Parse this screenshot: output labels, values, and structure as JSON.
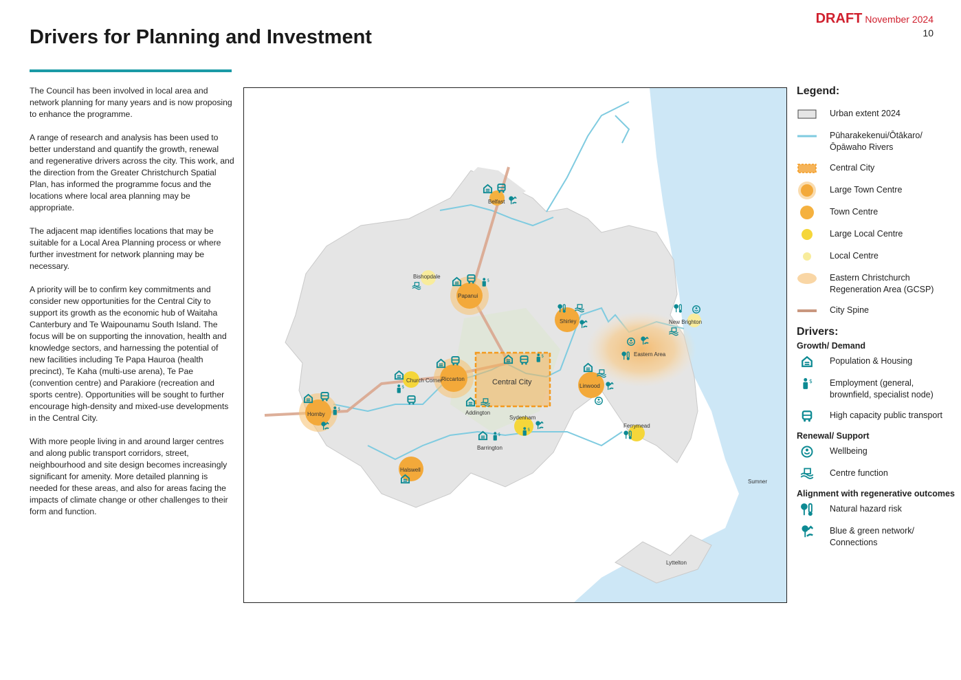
{
  "header": {
    "draft": "DRAFT",
    "date": "November 2024",
    "page": "10"
  },
  "title": "Drivers for Planning and Investment",
  "intro": [
    "The Council has been involved in local area and network planning for many years and is now proposing to enhance the programme.",
    "A range of research and analysis has been used to better understand and quantify the growth, renewal and regenerative drivers across the city. This work, and the direction from the Greater Christchurch Spatial Plan, has informed the programme focus and the locations where local area planning may be appropriate.",
    "The adjacent map identifies locations that may be suitable for a Local Area Planning process or where further investment for network planning may be necessary.",
    "A priority will be to confirm key commitments and consider new opportunities for the Central City to support its growth as the economic hub of Waitaha Canterbury and Te Waipounamu South Island. The focus will be on supporting the innovation, health and knowledge sectors, and harnessing the potential of new facilities including Te Papa Hauroa (health precinct), Te Kaha (multi-use arena), Te Pae (convention centre) and Parakiore (recreation and sports centre). Opportunities will be sought to further encourage high-density and mixed-use developments in the Central City.",
    "With more people living in and around larger centres and along public transport corridors, street, neighbourhood and site design becomes increasingly significant for amenity. More detailed planning is needed for these areas, and also for areas facing the impacts of climate change or other challenges to their form and function."
  ],
  "map": {
    "places": {
      "belfast": "Belfast",
      "bishopdale": "Bishopdale",
      "papanui": "Papanui",
      "shirley": "Shirley",
      "new_brighton": "New Brighton",
      "eastern_area": "Eastern Area",
      "church_corner": "Church Corner",
      "riccarton": "Riccarton",
      "central_city": "Central City",
      "linwood": "Linwood",
      "hornby": "Hornby",
      "addington": "Addington",
      "sydenham": "Sydenham",
      "barrington": "Barrington",
      "ferrymead": "Ferrymead",
      "halswell": "Halswell",
      "sumner": "Sumner",
      "lyttelton": "Lyttelton"
    },
    "colors": {
      "urban": "#e5e5e5",
      "sea": "#cde7f6",
      "river": "#7fcbe0",
      "large_town": "#f3a93a",
      "town": "#f5b13f",
      "large_local": "#f5d63a",
      "local": "#f8ec9c",
      "spine": "#d9a68e",
      "icon": "#0d8a93"
    }
  },
  "legend": {
    "title": "Legend:",
    "items": [
      {
        "label": "Urban extent 2024",
        "icon": "urban-extent"
      },
      {
        "label": "Pūharakekenui/Ōtākaro/ Ōpāwaho Rivers",
        "icon": "river-line"
      },
      {
        "label": "Central City",
        "icon": "central-city-hatch"
      },
      {
        "label": "Large Town Centre",
        "icon": "large-town-circle"
      },
      {
        "label": "Town Centre",
        "icon": "town-circle"
      },
      {
        "label": "Large Local Centre",
        "icon": "large-local-circle"
      },
      {
        "label": "Local Centre",
        "icon": "local-circle"
      },
      {
        "label": "Eastern Christchurch Regeneration Area (GCSP)",
        "icon": "regeneration-blob"
      },
      {
        "label": "City Spine",
        "icon": "spine-line"
      }
    ],
    "drivers_title": "Drivers:",
    "growth_title": "Growth/ Demand",
    "growth": [
      {
        "label": "Population & Housing",
        "icon": "house-icon"
      },
      {
        "label": "Employment (general, brownfield, specialist node)",
        "icon": "employment-icon"
      },
      {
        "label": "High capacity public transport",
        "icon": "bus-icon"
      }
    ],
    "renewal_title": "Renewal/ Support",
    "renewal": [
      {
        "label": "Wellbeing",
        "icon": "wellbeing-icon"
      },
      {
        "label": "Centre function",
        "icon": "centre-function-icon"
      }
    ],
    "align_title": "Alignment with regenerative outcomes",
    "align": [
      {
        "label": "Natural hazard risk",
        "icon": "hazard-icon"
      },
      {
        "label": "Blue & green network/ Connections",
        "icon": "blue-green-icon"
      }
    ]
  }
}
